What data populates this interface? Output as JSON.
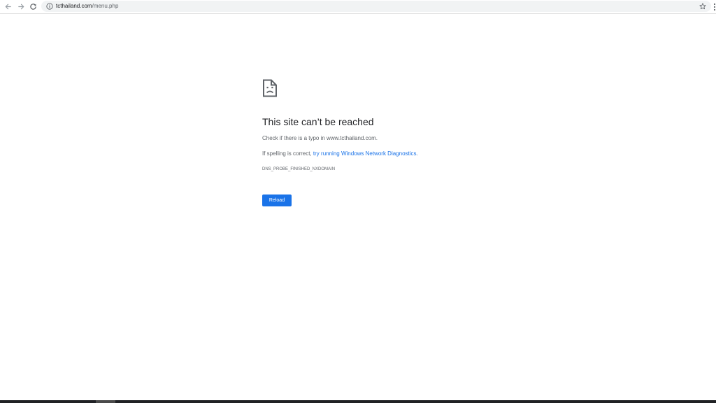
{
  "browser": {
    "url_domain": "tcthailand.com",
    "url_path": "/menu.php",
    "icons": {
      "back": "arrow-left-icon",
      "forward": "arrow-right-icon",
      "reload": "reload-icon",
      "info": "info-icon",
      "bookmark": "star-icon",
      "menu": "kebab-menu-icon"
    }
  },
  "error_page": {
    "icon": "sad-document-icon",
    "title": "This site can’t be reached",
    "line1": "Check if there is a typo in www.tcthailand.com.",
    "line2_prefix": "If spelling is correct, ",
    "line2_link": "try running Windows Network Diagnostics",
    "line2_suffix": ".",
    "error_code": "DNS_PROBE_FINISHED_NXDOMAIN",
    "reload_label": "Reload"
  },
  "colors": {
    "accent": "#1a73e8",
    "text_primary": "#202124",
    "text_secondary": "#5f6368",
    "omnibox_bg": "#f1f3f4"
  }
}
